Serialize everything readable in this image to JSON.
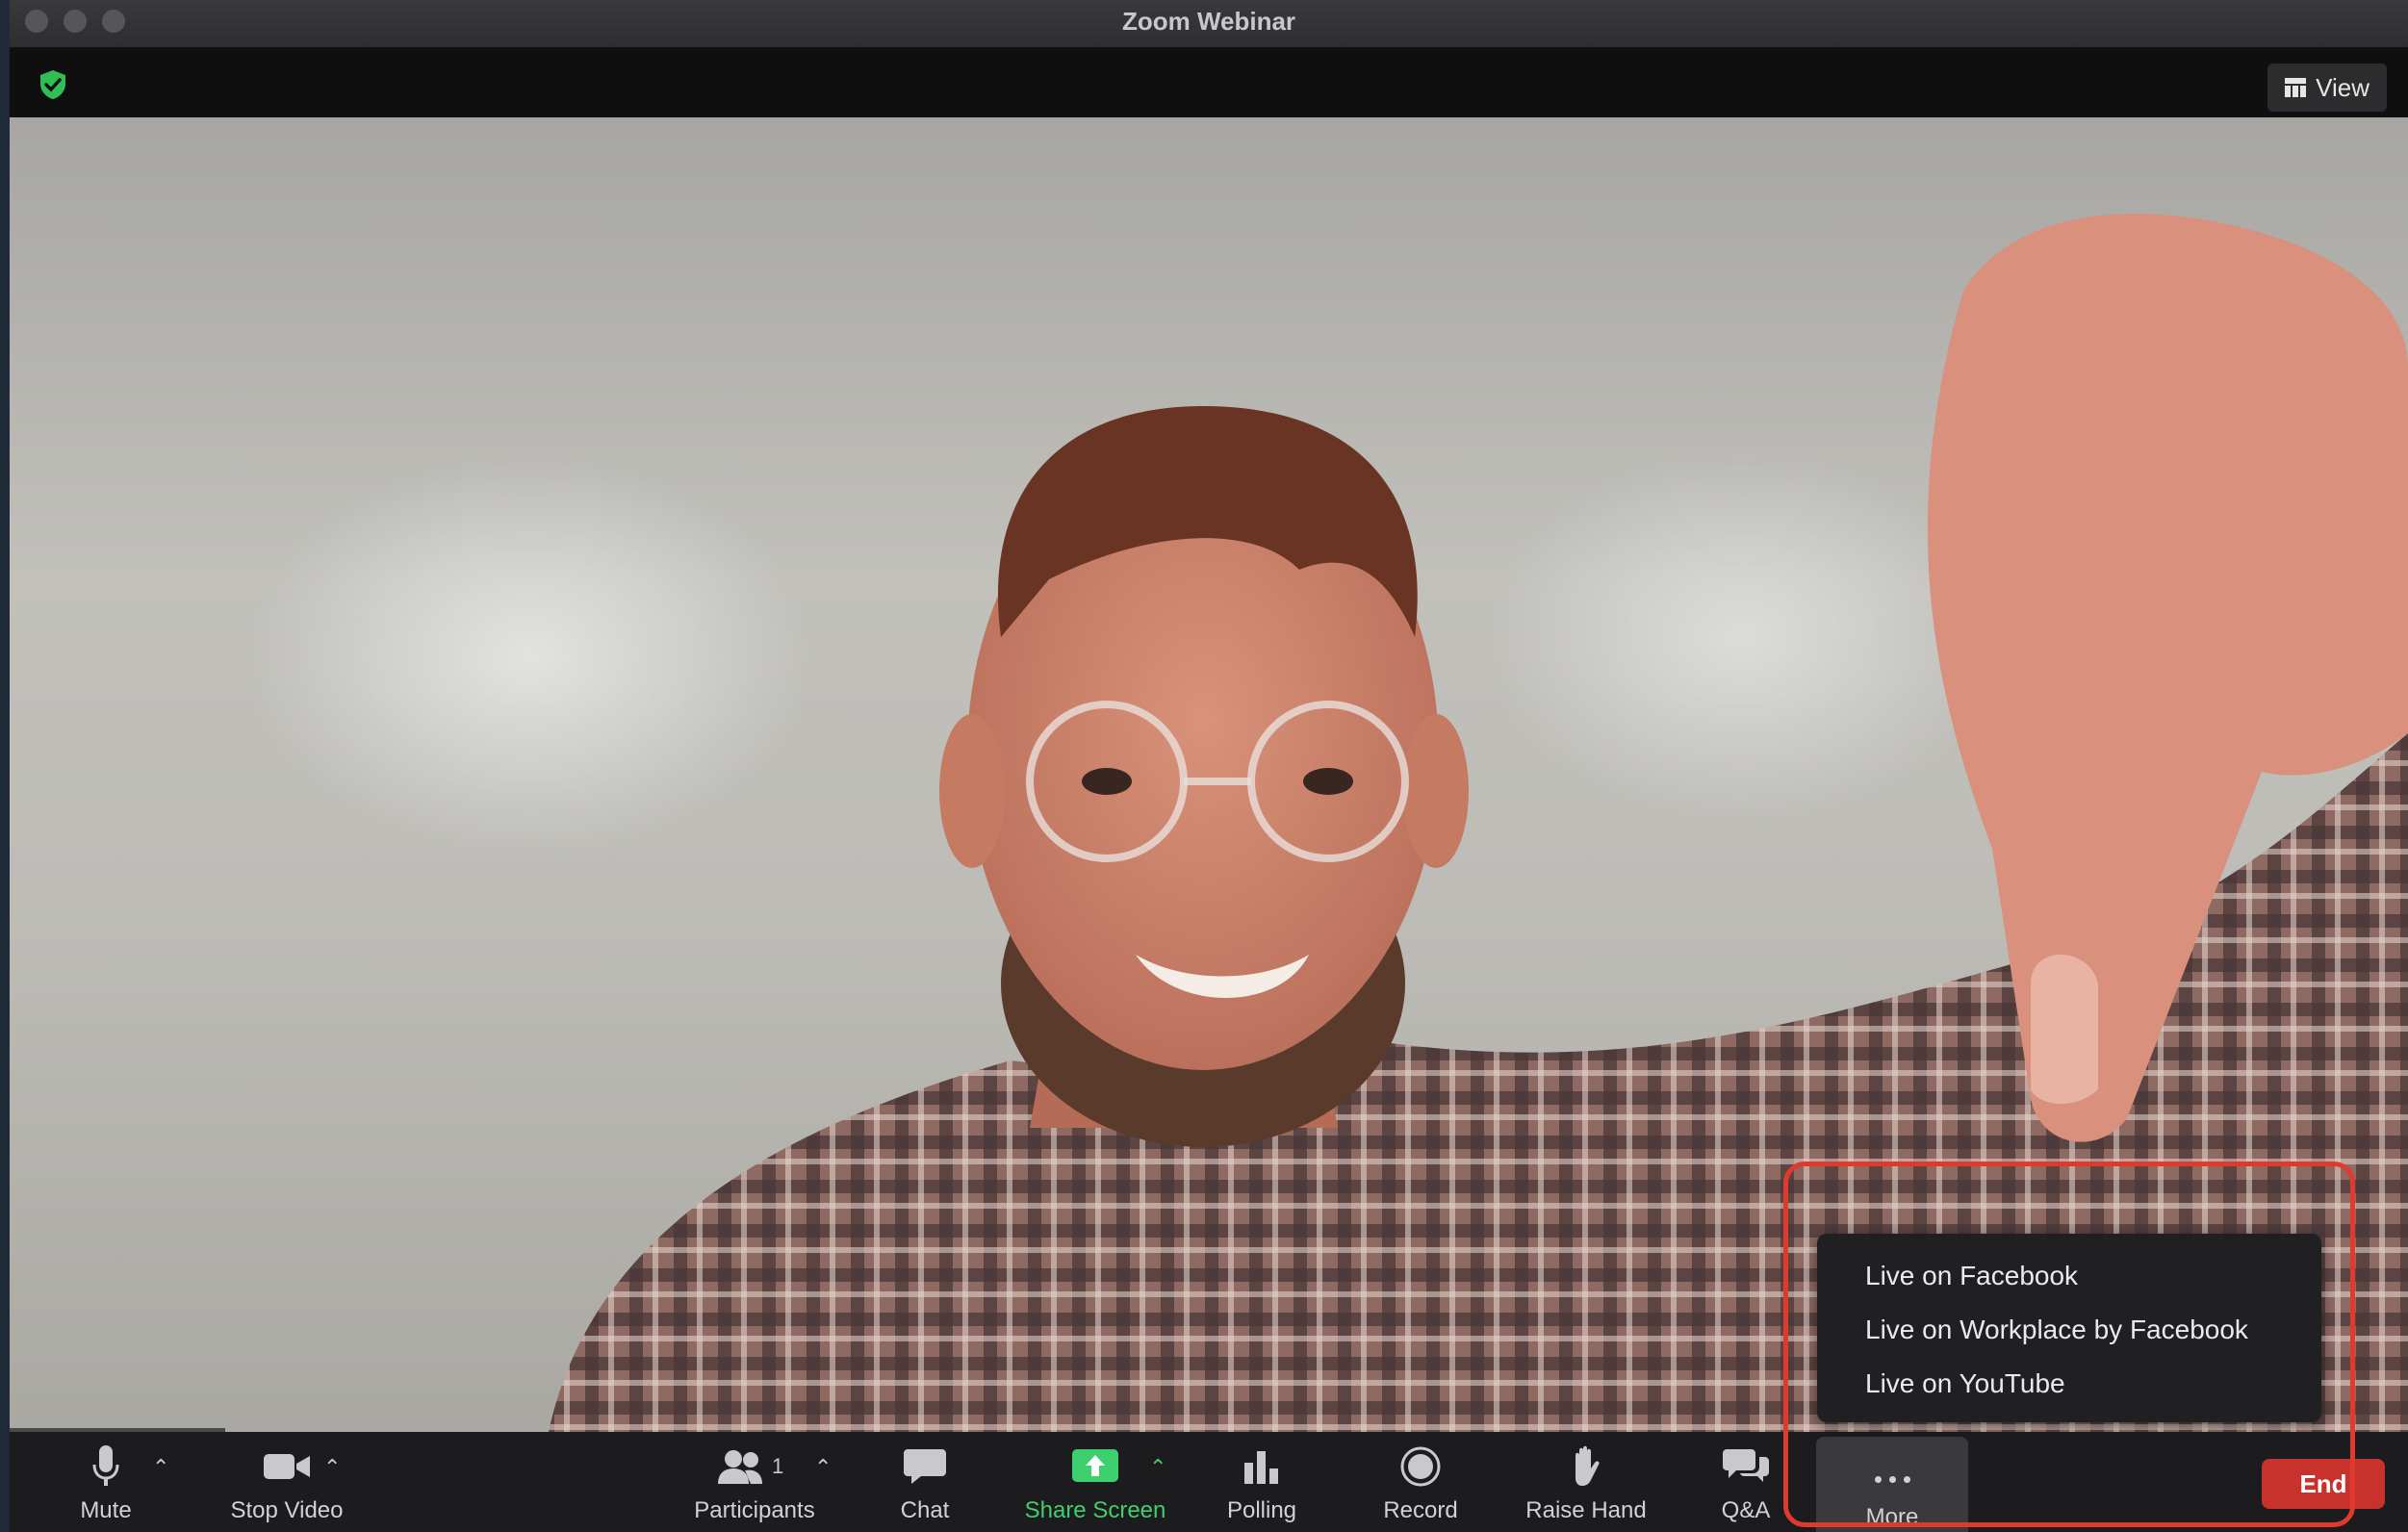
{
  "window": {
    "title": "Zoom Webinar"
  },
  "topbar": {
    "view_label": "View"
  },
  "toolbar": {
    "mute_label": "Mute",
    "stop_video_label": "Stop Video",
    "participants_label": "Participants",
    "participants_count": "1",
    "chat_label": "Chat",
    "share_screen_label": "Share Screen",
    "polling_label": "Polling",
    "record_label": "Record",
    "raise_hand_label": "Raise Hand",
    "qa_label": "Q&A",
    "more_label": "More",
    "end_label": "End"
  },
  "more_menu": {
    "items": [
      "Live on Facebook",
      "Live on Workplace by Facebook",
      "Live on YouTube"
    ]
  },
  "colors": {
    "accent_green": "#3ecf6e",
    "end_red": "#c7322c",
    "highlight_red": "#e0392d",
    "shield_green": "#2fbf55"
  },
  "icons": [
    "shield-check-icon",
    "grid-icon",
    "microphone-icon",
    "video-camera-icon",
    "participants-icon",
    "chat-bubble-icon",
    "share-arrow-icon",
    "bar-chart-icon",
    "record-icon",
    "hand-icon",
    "qa-icon",
    "ellipsis-icon"
  ]
}
